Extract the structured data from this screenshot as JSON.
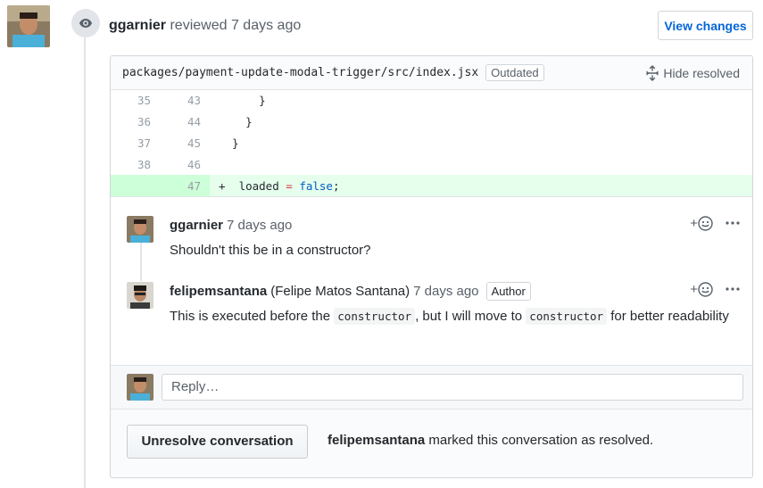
{
  "review": {
    "author": "ggarnier",
    "action": "reviewed",
    "time": "7 days ago",
    "view_changes_label": "View changes"
  },
  "file": {
    "path": "packages/payment-update-modal-trigger/src/index.jsx",
    "outdated_label": "Outdated",
    "hide_resolved_label": "Hide resolved"
  },
  "diff": [
    {
      "old": "35",
      "new": "43",
      "marker": "",
      "code": "      }",
      "added": false
    },
    {
      "old": "36",
      "new": "44",
      "marker": "",
      "code": "    }",
      "added": false
    },
    {
      "old": "37",
      "new": "45",
      "marker": "",
      "code": "  }",
      "added": false
    },
    {
      "old": "38",
      "new": "46",
      "marker": "",
      "code": "",
      "added": false
    },
    {
      "old": "",
      "new": "47",
      "marker": "+",
      "code_parts": [
        "  loaded ",
        "=",
        " ",
        "false",
        ";"
      ],
      "added": true
    }
  ],
  "comments": [
    {
      "author": "ggarnier",
      "time": "7 days ago",
      "text": "Shouldn't this be in a constructor?"
    },
    {
      "author": "felipemsantana",
      "fullname": "(Felipe Matos Santana)",
      "time": "7 days ago",
      "badge": "Author",
      "text_before": "This is executed before the ",
      "code1": "constructor",
      "text_mid": ", but I will move to ",
      "code2": "constructor",
      "text_after": " for better readability"
    }
  ],
  "reply": {
    "placeholder": "Reply…"
  },
  "resolve": {
    "button_label": "Unresolve conversation",
    "resolver": "felipemsantana",
    "message": " marked this conversation as resolved."
  },
  "icons": {
    "eye": "eye-icon",
    "unfold": "unfold-icon",
    "smiley": "smiley-icon",
    "kebab": "kebab-horizontal-icon"
  }
}
